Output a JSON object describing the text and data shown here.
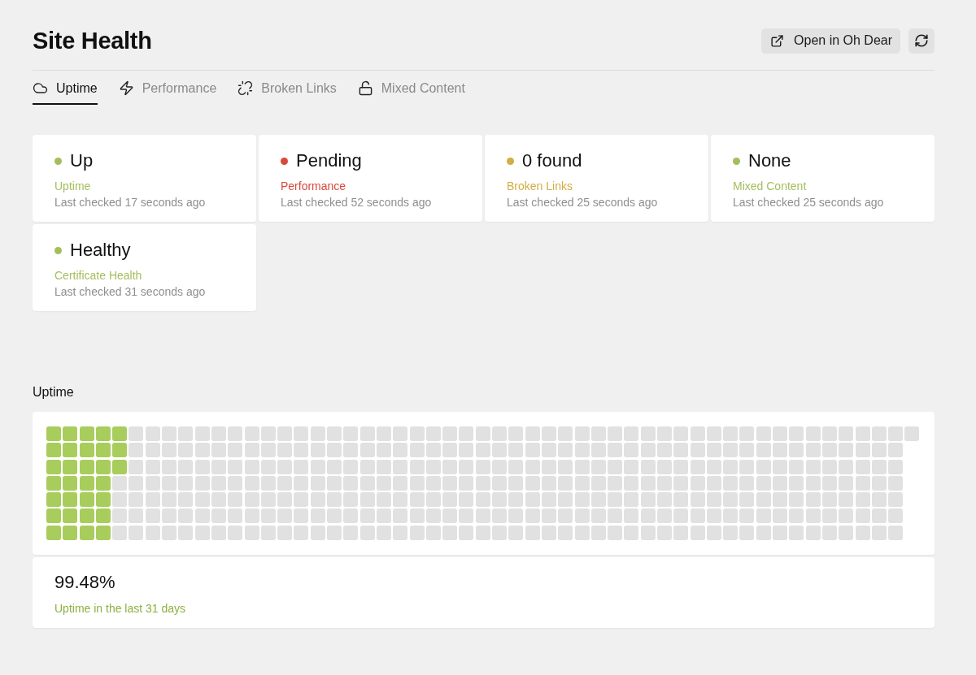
{
  "page": {
    "title": "Site Health"
  },
  "open_button": {
    "label": "Open in Oh Dear"
  },
  "tabs": [
    {
      "label": "Uptime",
      "selected": true
    },
    {
      "label": "Performance",
      "selected": false
    },
    {
      "label": "Broken Links",
      "selected": false
    },
    {
      "label": "Mixed Content",
      "selected": false
    }
  ],
  "status_cards": [
    {
      "status": "Up",
      "label": "Uptime",
      "checked": "Last checked 17 seconds ago",
      "color": "#a3bf5c"
    },
    {
      "status": "Pending",
      "label": "Performance",
      "checked": "Last checked 52 seconds ago",
      "color": "#d84a3c"
    },
    {
      "status": "0 found",
      "label": "Broken Links",
      "checked": "Last checked 25 seconds ago",
      "color": "#d3ad45"
    },
    {
      "status": "None",
      "label": "Mixed Content",
      "checked": "Last checked 25 seconds ago",
      "color": "#a3bf5c"
    },
    {
      "status": "Healthy",
      "label": "Certificate Health",
      "checked": "Last checked 31 seconds ago",
      "color": "#a3bf5c"
    }
  ],
  "uptime": {
    "heading": "Uptime",
    "percentage": "99.48%",
    "caption": "Uptime in the last 31 days",
    "days": [
      {
        "up": true
      },
      {
        "up": true
      },
      {
        "up": true
      },
      {
        "up": true
      },
      {
        "up": true
      },
      {
        "up": true
      },
      {
        "up": true
      },
      {
        "up": true
      },
      {
        "up": true
      },
      {
        "up": true
      },
      {
        "up": true
      },
      {
        "up": true
      },
      {
        "up": true
      },
      {
        "up": true
      },
      {
        "up": true
      },
      {
        "up": true
      },
      {
        "up": true
      },
      {
        "up": true
      },
      {
        "up": true
      },
      {
        "up": true
      },
      {
        "up": true
      },
      {
        "up": true
      },
      {
        "up": true
      },
      {
        "up": true
      },
      {
        "up": true
      },
      {
        "up": true
      },
      {
        "up": true
      },
      {
        "up": true
      },
      {
        "up": true
      },
      {
        "up": true
      },
      {
        "up": true
      },
      {
        "up": false
      },
      {
        "up": false
      },
      {
        "up": false
      },
      {
        "up": false
      },
      {
        "up": false
      },
      {
        "up": false
      },
      {
        "up": false
      },
      {
        "up": false
      },
      {
        "up": false
      },
      {
        "up": false
      },
      {
        "up": false
      },
      {
        "up": false
      },
      {
        "up": false
      },
      {
        "up": false
      },
      {
        "up": false
      },
      {
        "up": false
      },
      {
        "up": false
      },
      {
        "up": false
      },
      {
        "up": false
      },
      {
        "up": false
      },
      {
        "up": false
      },
      {
        "up": false
      },
      {
        "up": false
      },
      {
        "up": false
      },
      {
        "up": false
      },
      {
        "up": false
      },
      {
        "up": false
      },
      {
        "up": false
      },
      {
        "up": false
      },
      {
        "up": false
      },
      {
        "up": false
      },
      {
        "up": false
      },
      {
        "up": false
      },
      {
        "up": false
      },
      {
        "up": false
      },
      {
        "up": false
      },
      {
        "up": false
      },
      {
        "up": false
      },
      {
        "up": false
      },
      {
        "up": false
      },
      {
        "up": false
      },
      {
        "up": false
      },
      {
        "up": false
      },
      {
        "up": false
      },
      {
        "up": false
      },
      {
        "up": false
      },
      {
        "up": false
      },
      {
        "up": false
      },
      {
        "up": false
      },
      {
        "up": false
      },
      {
        "up": false
      },
      {
        "up": false
      },
      {
        "up": false
      },
      {
        "up": false
      },
      {
        "up": false
      },
      {
        "up": false
      },
      {
        "up": false
      },
      {
        "up": false
      },
      {
        "up": false
      },
      {
        "up": false
      },
      {
        "up": false
      },
      {
        "up": false
      },
      {
        "up": false
      },
      {
        "up": false
      },
      {
        "up": false
      },
      {
        "up": false
      },
      {
        "up": false
      },
      {
        "up": false
      },
      {
        "up": false
      },
      {
        "up": false
      },
      {
        "up": false
      },
      {
        "up": false
      },
      {
        "up": false
      },
      {
        "up": false
      },
      {
        "up": false
      },
      {
        "up": false
      },
      {
        "up": false
      },
      {
        "up": false
      },
      {
        "up": false
      },
      {
        "up": false
      },
      {
        "up": false
      },
      {
        "up": false
      },
      {
        "up": false
      },
      {
        "up": false
      },
      {
        "up": false
      },
      {
        "up": false
      },
      {
        "up": false
      },
      {
        "up": false
      },
      {
        "up": false
      },
      {
        "up": false
      },
      {
        "up": false
      },
      {
        "up": false
      },
      {
        "up": false
      },
      {
        "up": false
      },
      {
        "up": false
      },
      {
        "up": false
      },
      {
        "up": false
      },
      {
        "up": false
      },
      {
        "up": false
      },
      {
        "up": false
      },
      {
        "up": false
      },
      {
        "up": false
      },
      {
        "up": false
      },
      {
        "up": false
      },
      {
        "up": false
      },
      {
        "up": false
      },
      {
        "up": false
      },
      {
        "up": false
      },
      {
        "up": false
      },
      {
        "up": false
      },
      {
        "up": false
      },
      {
        "up": false
      },
      {
        "up": false
      },
      {
        "up": false
      },
      {
        "up": false
      },
      {
        "up": false
      },
      {
        "up": false
      },
      {
        "up": false
      },
      {
        "up": false
      },
      {
        "up": false
      },
      {
        "up": false
      },
      {
        "up": false
      },
      {
        "up": false
      },
      {
        "up": false
      },
      {
        "up": false
      },
      {
        "up": false
      },
      {
        "up": false
      },
      {
        "up": false
      },
      {
        "up": false
      },
      {
        "up": false
      },
      {
        "up": false
      },
      {
        "up": false
      },
      {
        "up": false
      },
      {
        "up": false
      },
      {
        "up": false
      },
      {
        "up": false
      },
      {
        "up": false
      },
      {
        "up": false
      },
      {
        "up": false
      },
      {
        "up": false
      },
      {
        "up": false
      },
      {
        "up": false
      },
      {
        "up": false
      },
      {
        "up": false
      },
      {
        "up": false
      },
      {
        "up": false
      },
      {
        "up": false
      },
      {
        "up": false
      },
      {
        "up": false
      },
      {
        "up": false
      },
      {
        "up": false
      },
      {
        "up": false
      },
      {
        "up": false
      },
      {
        "up": false
      },
      {
        "up": false
      },
      {
        "up": false
      },
      {
        "up": false
      },
      {
        "up": false
      },
      {
        "up": false
      },
      {
        "up": false
      },
      {
        "up": false
      },
      {
        "up": false
      },
      {
        "up": false
      },
      {
        "up": false
      },
      {
        "up": false
      },
      {
        "up": false
      },
      {
        "up": false
      },
      {
        "up": false
      },
      {
        "up": false
      },
      {
        "up": false
      },
      {
        "up": false
      },
      {
        "up": false
      },
      {
        "up": false
      },
      {
        "up": false
      },
      {
        "up": false
      },
      {
        "up": false
      },
      {
        "up": false
      },
      {
        "up": false
      },
      {
        "up": false
      },
      {
        "up": false
      },
      {
        "up": false
      },
      {
        "up": false
      },
      {
        "up": false
      },
      {
        "up": false
      },
      {
        "up": false
      },
      {
        "up": false
      },
      {
        "up": false
      },
      {
        "up": false
      },
      {
        "up": false
      },
      {
        "up": false
      },
      {
        "up": false
      },
      {
        "up": false
      },
      {
        "up": false
      },
      {
        "up": false
      },
      {
        "up": false
      },
      {
        "up": false
      },
      {
        "up": false
      },
      {
        "up": false
      },
      {
        "up": false
      },
      {
        "up": false
      },
      {
        "up": false
      },
      {
        "up": false
      },
      {
        "up": false
      },
      {
        "up": false
      },
      {
        "up": false
      },
      {
        "up": false
      },
      {
        "up": false
      },
      {
        "up": false
      },
      {
        "up": false
      },
      {
        "up": false
      },
      {
        "up": false
      },
      {
        "up": false
      },
      {
        "up": false
      },
      {
        "up": false
      },
      {
        "up": false
      },
      {
        "up": false
      },
      {
        "up": false
      },
      {
        "up": false
      },
      {
        "up": false
      },
      {
        "up": false
      },
      {
        "up": false
      },
      {
        "up": false
      },
      {
        "up": false
      },
      {
        "up": false
      },
      {
        "up": false
      },
      {
        "up": false
      },
      {
        "up": false
      },
      {
        "up": false
      },
      {
        "up": false
      },
      {
        "up": false
      },
      {
        "up": false
      },
      {
        "up": false
      },
      {
        "up": false
      },
      {
        "up": false
      },
      {
        "up": false
      },
      {
        "up": false
      },
      {
        "up": false
      },
      {
        "up": false
      },
      {
        "up": false
      },
      {
        "up": false
      },
      {
        "up": false
      },
      {
        "up": false
      },
      {
        "up": false
      },
      {
        "up": false
      },
      {
        "up": false
      },
      {
        "up": false
      },
      {
        "up": false
      },
      {
        "up": false
      },
      {
        "up": false
      },
      {
        "up": false
      },
      {
        "up": false
      },
      {
        "up": false
      },
      {
        "up": false
      },
      {
        "up": false
      },
      {
        "up": false
      },
      {
        "up": false
      },
      {
        "up": false
      },
      {
        "up": false
      },
      {
        "up": false
      },
      {
        "up": false
      },
      {
        "up": false
      },
      {
        "up": false
      },
      {
        "up": false
      },
      {
        "up": false
      },
      {
        "up": false
      },
      {
        "up": false
      },
      {
        "up": false
      },
      {
        "up": false
      },
      {
        "up": false
      },
      {
        "up": false
      },
      {
        "up": false
      },
      {
        "up": false
      },
      {
        "up": false
      },
      {
        "up": false
      },
      {
        "up": false
      },
      {
        "up": false
      },
      {
        "up": false
      },
      {
        "up": false
      },
      {
        "up": false
      },
      {
        "up": false
      },
      {
        "up": false
      },
      {
        "up": false
      },
      {
        "up": false
      },
      {
        "up": false
      },
      {
        "up": false
      },
      {
        "up": false
      },
      {
        "up": false
      },
      {
        "up": false
      },
      {
        "up": false
      },
      {
        "up": false
      },
      {
        "up": false
      },
      {
        "up": false
      },
      {
        "up": false
      },
      {
        "up": false
      },
      {
        "up": false
      },
      {
        "up": false
      },
      {
        "up": false
      },
      {
        "up": false
      },
      {
        "up": false
      },
      {
        "up": false
      },
      {
        "up": false
      },
      {
        "up": false
      },
      {
        "up": false
      },
      {
        "up": false
      },
      {
        "up": false
      },
      {
        "up": false
      },
      {
        "up": false
      },
      {
        "up": false
      },
      {
        "up": false
      },
      {
        "up": false
      },
      {
        "up": false
      },
      {
        "up": false
      },
      {
        "up": false
      },
      {
        "up": false
      },
      {
        "up": false
      },
      {
        "up": false
      },
      {
        "up": false
      },
      {
        "up": false
      },
      {
        "up": false
      },
      {
        "up": false
      },
      {
        "up": false
      },
      {
        "up": false
      },
      {
        "up": false
      },
      {
        "up": false
      },
      {
        "up": false
      },
      {
        "up": false
      },
      {
        "up": false
      },
      {
        "up": false
      },
      {
        "up": false
      },
      {
        "up": false
      },
      {
        "up": false
      },
      {
        "up": false
      },
      {
        "up": false
      },
      {
        "up": false
      }
    ]
  }
}
